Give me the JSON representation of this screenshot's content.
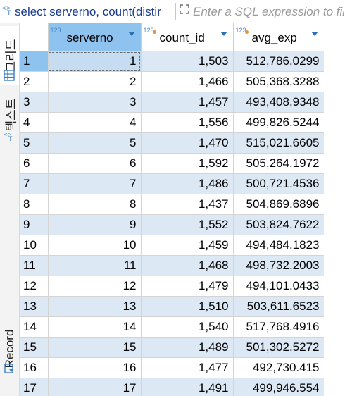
{
  "toolbar": {
    "sql_text": "select serverno, count(distir",
    "filter_placeholder": "Enter a SQL expression to filter results"
  },
  "sidebar": {
    "tabs": [
      {
        "label": "그리드",
        "icon": "grid-icon",
        "active": true
      },
      {
        "label": "텍스트",
        "icon": "text-icon",
        "active": false
      },
      {
        "label": "Record",
        "icon": "record-icon",
        "active": false
      }
    ]
  },
  "columns": [
    {
      "name": "serverno",
      "type_badge": "123",
      "selected": true
    },
    {
      "name": "count_id",
      "type_badge": "123",
      "selected": false
    },
    {
      "name": "avg_exp",
      "type_badge": "123",
      "selected": false
    }
  ],
  "rows": [
    {
      "n": "1",
      "serverno": "1",
      "count_id": "1,503",
      "avg_exp": "512,786.0299"
    },
    {
      "n": "2",
      "serverno": "2",
      "count_id": "1,466",
      "avg_exp": "505,368.3288"
    },
    {
      "n": "3",
      "serverno": "3",
      "count_id": "1,457",
      "avg_exp": "493,408.9348"
    },
    {
      "n": "4",
      "serverno": "4",
      "count_id": "1,556",
      "avg_exp": "499,826.5244"
    },
    {
      "n": "5",
      "serverno": "5",
      "count_id": "1,470",
      "avg_exp": "515,021.6605"
    },
    {
      "n": "6",
      "serverno": "6",
      "count_id": "1,592",
      "avg_exp": "505,264.1972"
    },
    {
      "n": "7",
      "serverno": "7",
      "count_id": "1,486",
      "avg_exp": "500,721.4536"
    },
    {
      "n": "8",
      "serverno": "8",
      "count_id": "1,437",
      "avg_exp": "504,869.6896"
    },
    {
      "n": "9",
      "serverno": "9",
      "count_id": "1,552",
      "avg_exp": "503,824.7622"
    },
    {
      "n": "10",
      "serverno": "10",
      "count_id": "1,459",
      "avg_exp": "494,484.1823"
    },
    {
      "n": "11",
      "serverno": "11",
      "count_id": "1,468",
      "avg_exp": "498,732.2003"
    },
    {
      "n": "12",
      "serverno": "12",
      "count_id": "1,479",
      "avg_exp": "494,101.0433"
    },
    {
      "n": "13",
      "serverno": "13",
      "count_id": "1,510",
      "avg_exp": "503,611.6523"
    },
    {
      "n": "14",
      "serverno": "14",
      "count_id": "1,540",
      "avg_exp": "517,768.4916"
    },
    {
      "n": "15",
      "serverno": "15",
      "count_id": "1,489",
      "avg_exp": "501,302.5272"
    },
    {
      "n": "16",
      "serverno": "16",
      "count_id": "1,477",
      "avg_exp": "492,730.415"
    },
    {
      "n": "17",
      "serverno": "17",
      "count_id": "1,491",
      "avg_exp": "499,946.554"
    }
  ],
  "colors": {
    "accent": "#8fc3ef",
    "stripe": "#dde8f5",
    "sql": "#1b3b8f"
  }
}
